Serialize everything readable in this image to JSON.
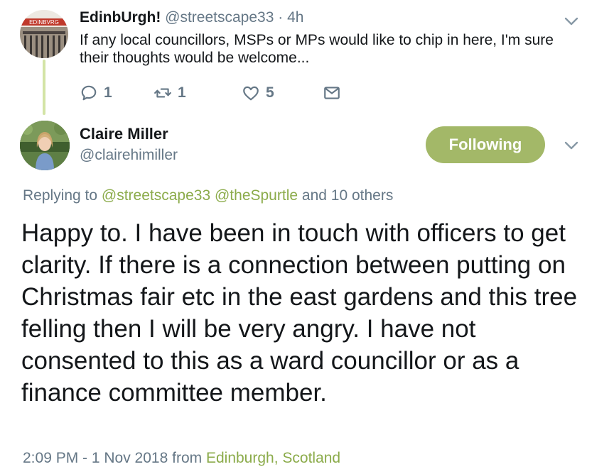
{
  "tweet1": {
    "name": "EdinbUrgh!",
    "handle": "@streetscape33",
    "separator": " · ",
    "age": "4h",
    "text": "If any local councillors, MSPs or MPs would like to chip in here, I'm sure their thoughts would be welcome...",
    "avatar_sign_text": "EDINBVRG",
    "actions": {
      "reply_count": "1",
      "retweet_count": "1",
      "like_count": "5"
    }
  },
  "tweet2": {
    "name": "Claire Miller",
    "handle": "@clairehimiller",
    "follow_label": "Following",
    "replying_prefix": "Replying to",
    "mention1": "@streetscape33",
    "mention2": "@theSpurtle",
    "others": "and 10 others",
    "text": "Happy to. I have been in touch with officers to get clarity. If there is a connection between putting on Christmas fair etc in the east gardens and this tree felling then I will be very angry. I have not consented to this as a ward councillor or as a finance committee member.",
    "timestamp": "2:09 PM - 1 Nov 2018 from",
    "location": "Edinburgh, Scotland"
  },
  "colors": {
    "accent_green": "#a3b868",
    "link_green": "#8bab4a",
    "thread_line": "#d3e4a6",
    "muted": "#657786",
    "text": "#14171a"
  },
  "icons": [
    "reply-icon",
    "retweet-icon",
    "like-icon",
    "direct-message-icon",
    "chevron-down-icon"
  ]
}
